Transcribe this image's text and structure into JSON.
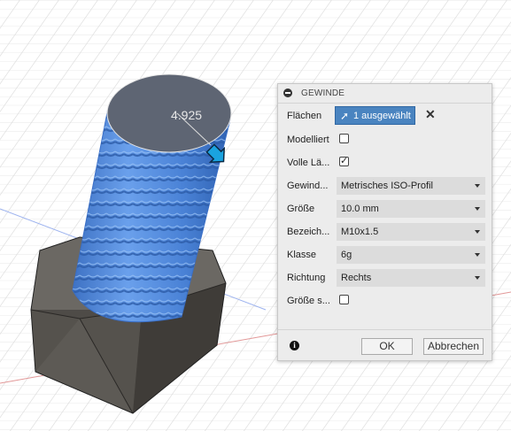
{
  "viewport": {
    "dimension_value": "4.925",
    "colors": {
      "thread": "#4f86d6",
      "bolt_head": "#5a5752",
      "grid": "#d8d8d8",
      "axis_red": "#e06666",
      "axis_blue": "#8fa8ea"
    },
    "icons": {
      "direction": "arrow-manipulator-icon"
    }
  },
  "panel": {
    "title": "GEWINDE",
    "rows": {
      "flaechen": {
        "label": "Flächen",
        "selection": "1 ausgewählt"
      },
      "modelliert": {
        "label": "Modelliert",
        "checked": false
      },
      "volle_laenge": {
        "label": "Volle Lä...",
        "checked": true
      },
      "gewindetyp": {
        "label": "Gewind...",
        "value": "Metrisches ISO-Profil"
      },
      "groesse": {
        "label": "Größe",
        "value": "10.0 mm"
      },
      "bezeichnung": {
        "label": "Bezeich...",
        "value": "M10x1.5"
      },
      "klasse": {
        "label": "Klasse",
        "value": "6g"
      },
      "richtung": {
        "label": "Richtung",
        "value": "Rechts"
      },
      "groesse_speichern": {
        "label": "Größe s...",
        "checked": false
      }
    },
    "buttons": {
      "ok": "OK",
      "cancel": "Abbrechen"
    },
    "check_mark": "✓",
    "cursor_glyph": "➚",
    "clear_glyph": "✕",
    "info_glyph": "i"
  }
}
